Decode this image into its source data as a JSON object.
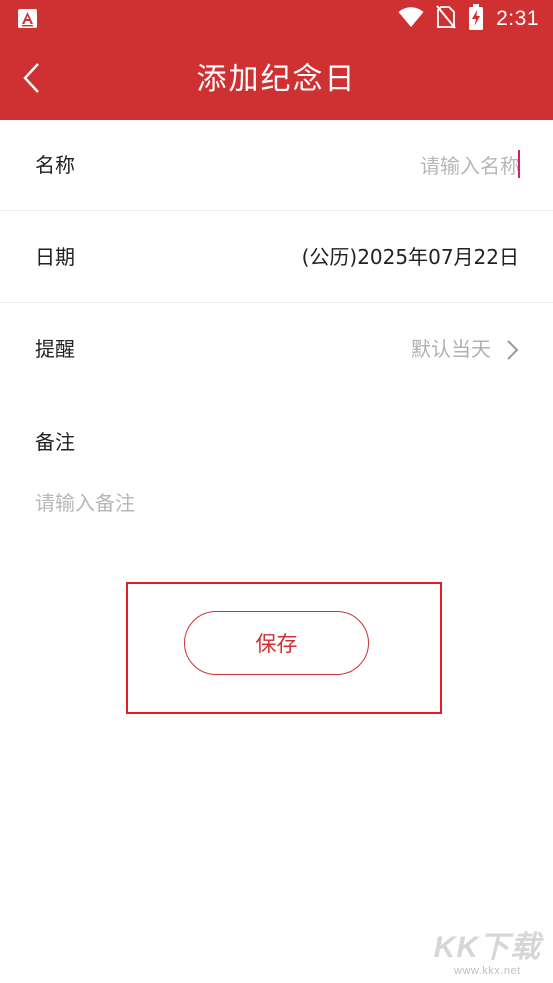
{
  "status_bar": {
    "time": "2:31",
    "icons": [
      "app-notification-icon",
      "wifi-icon",
      "no-sim-icon",
      "battery-charging-icon"
    ]
  },
  "header": {
    "title": "添加纪念日",
    "back_icon": "chevron-left-icon"
  },
  "form": {
    "name": {
      "label": "名称",
      "placeholder": "请输入名称",
      "value": ""
    },
    "date": {
      "label": "日期",
      "value": "(公历)2025年07月22日"
    },
    "remind": {
      "label": "提醒",
      "value": "默认当天",
      "icon": "chevron-right-icon"
    },
    "note": {
      "label": "备注",
      "placeholder": "请输入备注",
      "value": ""
    }
  },
  "actions": {
    "save_label": "保存"
  },
  "watermark": {
    "logo": "KK下载",
    "url": "www.kkx.net"
  },
  "colors": {
    "primary": "#cf3132",
    "placeholder": "#b7b7b7",
    "highlight": "#e02020",
    "cursor": "#d0245f"
  }
}
